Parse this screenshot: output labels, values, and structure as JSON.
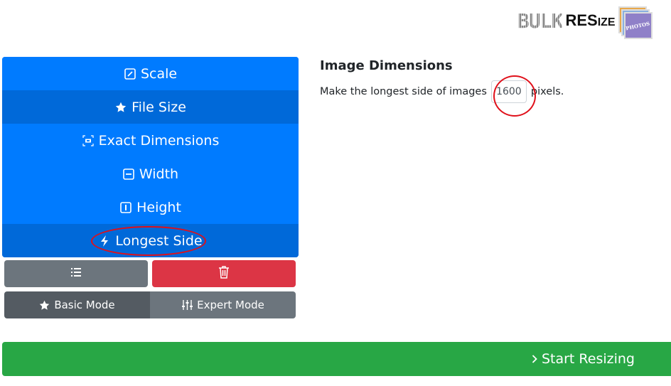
{
  "logo": {
    "bulk": "BULK",
    "resize_big": "RES",
    "resize_small": "IZE",
    "photos": "PHOTOS"
  },
  "menu": {
    "items": [
      {
        "label": "Scale",
        "icon": "pencil-square-icon",
        "active": false
      },
      {
        "label": "File Size",
        "icon": "star-icon",
        "active": true
      },
      {
        "label": "Exact Dimensions",
        "icon": "crop-focus-icon",
        "active": false
      },
      {
        "label": "Width",
        "icon": "dash-square-icon",
        "active": false
      },
      {
        "label": "Height",
        "icon": "i-square-icon",
        "active": false
      },
      {
        "label": "Longest Side",
        "icon": "lightning-icon",
        "active": true
      }
    ]
  },
  "actions": {
    "list_icon": "list-icon",
    "delete_icon": "trash-icon"
  },
  "modes": {
    "basic": "Basic Mode",
    "expert": "Expert Mode"
  },
  "panel": {
    "title": "Image Dimensions",
    "prefix": "Make the longest side of images",
    "value": "1600",
    "suffix": "pixels."
  },
  "start": {
    "label": "Start Resizing"
  },
  "colors": {
    "primary": "#007bff",
    "primary_active": "#0069d9",
    "secondary": "#6c757d",
    "danger": "#dc3545",
    "success": "#28a745",
    "annotation": "#e0101a"
  }
}
